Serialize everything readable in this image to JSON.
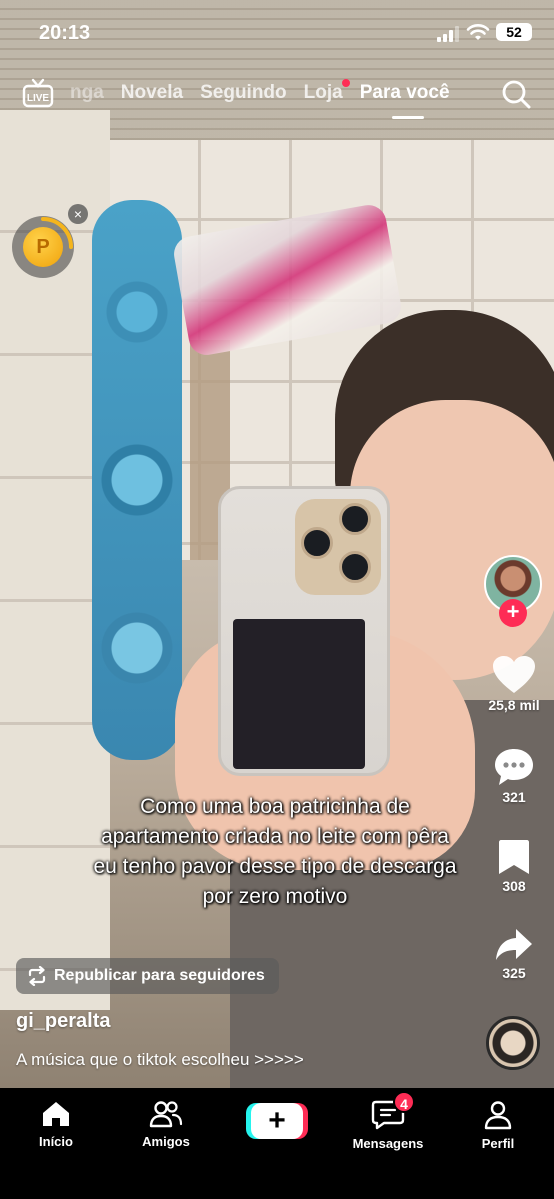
{
  "status_bar": {
    "time": "20:13",
    "battery": "52"
  },
  "top_nav": {
    "tabs": [
      {
        "label": "nga"
      },
      {
        "label": "Novela"
      },
      {
        "label": "Seguindo"
      },
      {
        "label": "Loja"
      },
      {
        "label": "Para você"
      }
    ],
    "live_icon": "live-tv-icon",
    "search_icon": "search-icon"
  },
  "coin_widget": {
    "symbol": "P",
    "close": "×"
  },
  "video": {
    "caption": "Como uma boa patricinha de apartamento criada no leite com pêra eu tenho pavor desse tipo de descarga por zero motivo"
  },
  "actions": {
    "follow": "+",
    "likes": "25,8 mil",
    "comments": "321",
    "saves": "308",
    "shares": "325"
  },
  "post": {
    "repost_label": "Republicar para seguidores",
    "username": "gi_peralta",
    "description": "A música que o tiktok escolheu >>>>>"
  },
  "tab_bar": {
    "home": "Início",
    "friends": "Amigos",
    "create": "+",
    "messages": "Mensagens",
    "messages_badge": "4",
    "profile": "Perfil"
  },
  "colors": {
    "accent": "#fe2c55",
    "cyan": "#25f4ee"
  }
}
